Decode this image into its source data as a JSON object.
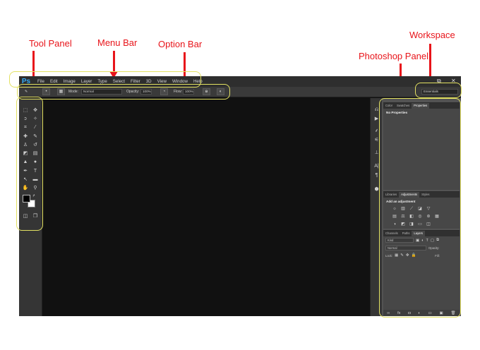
{
  "annotations": {
    "tool_panel": "Tool Panel",
    "menu_bar": "Menu Bar",
    "option_bar": "Option Bar",
    "workspace": "Workspace",
    "photoshop_panel": "Photoshop Panel"
  },
  "app": {
    "logo": "Ps"
  },
  "menu": {
    "file": "File",
    "edit": "Edit",
    "image": "Image",
    "layer": "Layer",
    "type": "Type",
    "select": "Select",
    "filter": "Filter",
    "threed": "3D",
    "view": "View",
    "window": "Window",
    "help": "Help"
  },
  "window_controls": {
    "close": "✕"
  },
  "options": {
    "mode_label": "Mode:",
    "mode_value": "Normal",
    "opacity_label": "Opacity:",
    "opacity_value": "100%",
    "flow_label": "Flow:",
    "flow_value": "100%",
    "workspace_value": "Essentials"
  },
  "panels": {
    "top_tabs": {
      "color": "Color",
      "swatches": "Swatches",
      "properties": "Properties"
    },
    "no_properties": "No Properties",
    "mid_tabs": {
      "libraries": "Libraries",
      "adjustments": "Adjustments",
      "styles": "Styles"
    },
    "add_adjustment": "Add an adjustment",
    "bottom_tabs": {
      "channels": "Channels",
      "paths": "Paths",
      "layers": "Layers"
    },
    "layers": {
      "kind": "Kind",
      "blend_mode": "Normal",
      "opacity_label": "Opacity:",
      "lock_label": "Lock:",
      "fill_label": "Fill:"
    }
  },
  "colors": {
    "annotation": "#e8141a",
    "highlight_ring": "#e3e162",
    "ps_blue": "#34a9f4",
    "canvas": "#111111"
  }
}
